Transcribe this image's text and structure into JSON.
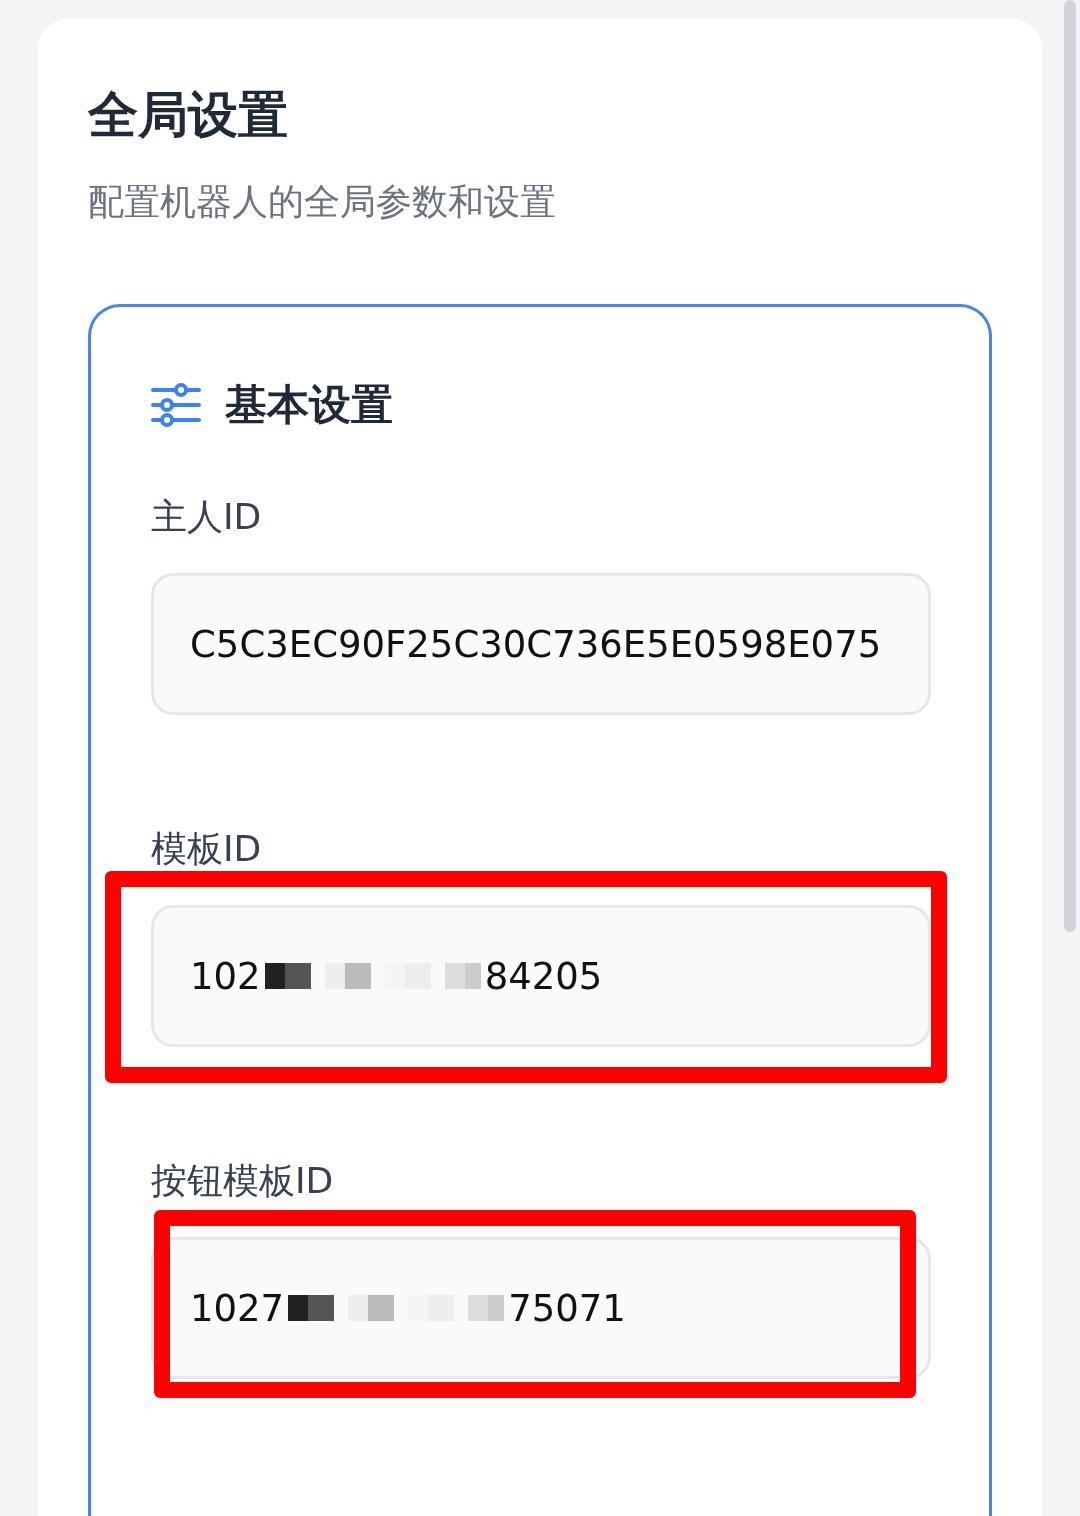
{
  "page": {
    "title": "全局设置",
    "subtitle": "配置机器人的全局参数和设置"
  },
  "section": {
    "title": "基本设置",
    "fields": [
      {
        "label": "主人ID",
        "kind": "plain",
        "value": "C5C3EC90F25C30C736E5E0598E075",
        "highlighted": false
      },
      {
        "label": "模板ID",
        "kind": "redacted",
        "prefix": "102",
        "suffix": "84205",
        "highlighted": true
      },
      {
        "label": "按钮模板ID",
        "kind": "redacted",
        "prefix": "1027",
        "suffix": "75071",
        "highlighted": true
      }
    ]
  }
}
